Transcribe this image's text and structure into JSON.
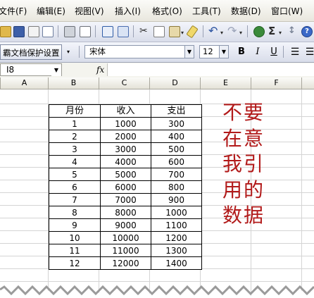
{
  "menu": [
    "文件(F)",
    "编辑(E)",
    "视图(V)",
    "插入(I)",
    "格式(O)",
    "工具(T)",
    "数据(D)",
    "窗口(W)"
  ],
  "toolbar": {
    "undo_glyph": "↶",
    "redo_glyph": "↷",
    "sigma_glyph": "Σ",
    "help_glyph": "?"
  },
  "format_toolbar": {
    "protect_label": "霸文档保护设置",
    "font_name": "宋体",
    "font_size": "12",
    "bold_label": "B",
    "italic_label": "I",
    "underline_label": "U"
  },
  "formula_bar": {
    "cell_ref": "I8",
    "fx_label": "fx",
    "value": ""
  },
  "columns": [
    "A",
    "B",
    "C",
    "D",
    "E",
    "F"
  ],
  "table": {
    "headers": [
      "月份",
      "收入",
      "支出"
    ],
    "rows": [
      [
        "1",
        "1000",
        "300"
      ],
      [
        "2",
        "2000",
        "400"
      ],
      [
        "3",
        "3000",
        "500"
      ],
      [
        "4",
        "4000",
        "600"
      ],
      [
        "5",
        "5000",
        "700"
      ],
      [
        "6",
        "6000",
        "800"
      ],
      [
        "7",
        "7000",
        "900"
      ],
      [
        "8",
        "8000",
        "1000"
      ],
      [
        "9",
        "9000",
        "1100"
      ],
      [
        "10",
        "10000",
        "1200"
      ],
      [
        "11",
        "11000",
        "1300"
      ],
      [
        "12",
        "12000",
        "1400"
      ]
    ]
  },
  "annotation": {
    "text": "不要在意我引用的数据",
    "color": "#b21a1a"
  },
  "colors": {
    "grid_line": "#d4d4d4",
    "toolbar_bg": "#dfe3ee"
  }
}
